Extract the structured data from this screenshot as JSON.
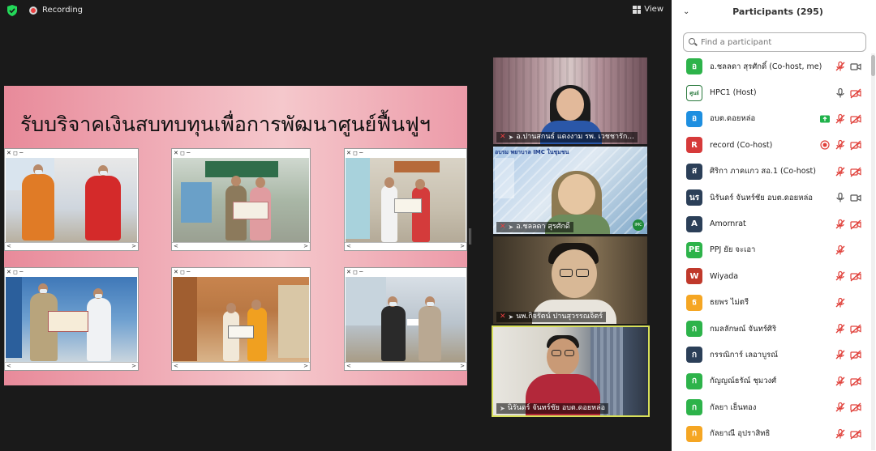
{
  "topbar": {
    "recording_label": "Recording",
    "view_label": "View"
  },
  "slide": {
    "title": "รับบริจาคเงินสบทบทุนเพื่อการพัฒนาศูนย์ฟื้นฟูฯ",
    "window_bar": "✕ ◻ ─",
    "scroll_left": "<",
    "scroll_right": ">"
  },
  "videos": [
    {
      "name": "อ.ปานสกนธ์ แดงงาม รพ. เวชชารัก..."
    },
    {
      "name": "อ.ชลลดา สุรศักดิ์",
      "overlay_text": "อบรม พยาบาล IMC ในชุมชน",
      "logo_text": "IMC"
    },
    {
      "name": "นพ.กิจรัตน์ ปานสุวรรณจิตร์"
    },
    {
      "name": "นิรันดร์ จันทร์ชัย อบต.ดอยหล่อ"
    }
  ],
  "participants": {
    "title": "Participants (295)",
    "search_placeholder": "Find a participant",
    "items": [
      {
        "initial": "อ",
        "name": "อ.ชลลดา สุรศักดิ์ (Co-host, me)",
        "color": "#2db34a",
        "mic": "muted",
        "video": "on"
      },
      {
        "initial": "ศูนย์",
        "name": "HPC1 (Host)",
        "color": "#ffffff",
        "mic": "on",
        "video": "off",
        "logo": true
      },
      {
        "initial": "อ",
        "name": "อบต.ดอยหล่อ",
        "color": "#1e8fe0",
        "mic": "muted",
        "video": "off",
        "share": true
      },
      {
        "initial": "R",
        "name": "record (Co-host)",
        "color": "#d63a3a",
        "mic": "muted",
        "video": "off",
        "recording": true
      },
      {
        "initial": "ส",
        "name": "ศิริกา ภาคแกว สอ.1 (Co-host)",
        "color": "#2b3f58",
        "mic": "muted",
        "video": "off"
      },
      {
        "initial": "นร",
        "name": "นิรันดร์ จันทร์ชัย อบต.ดอยหล่อ",
        "color": "#2b3f58",
        "mic": "on",
        "video": "on"
      },
      {
        "initial": "A",
        "name": "Amornrat",
        "color": "#2b3f58",
        "mic": "muted",
        "video": "off"
      },
      {
        "initial": "PE",
        "name": "PPJ ยัย จะเอา",
        "color": "#2db34a",
        "mic": "muted",
        "video": "none"
      },
      {
        "initial": "W",
        "name": "Wiyada",
        "color": "#c0392b",
        "mic": "muted",
        "video": "off"
      },
      {
        "initial": "ธ",
        "name": "ธยพร ไม่ตรี",
        "color": "#f5a623",
        "mic": "muted",
        "video": "none"
      },
      {
        "initial": "ก",
        "name": "กมลลักษณ์ จันทร์ศิริ",
        "color": "#2db34a",
        "mic": "muted",
        "video": "off"
      },
      {
        "initial": "ก",
        "name": "กรรณิการ์ เลอาบูรณ์",
        "color": "#2b3f58",
        "mic": "muted",
        "video": "off"
      },
      {
        "initial": "ก",
        "name": "กัญญณ์ธรัณ์ ชุมวงศ์",
        "color": "#2db34a",
        "mic": "muted",
        "video": "off"
      },
      {
        "initial": "ก",
        "name": "กัลยา เย็นทอง",
        "color": "#2db34a",
        "mic": "muted",
        "video": "off"
      },
      {
        "initial": "ก",
        "name": "กัลยาณี อุปราสิทธิ",
        "color": "#f5a623",
        "mic": "muted",
        "video": "off"
      }
    ]
  }
}
